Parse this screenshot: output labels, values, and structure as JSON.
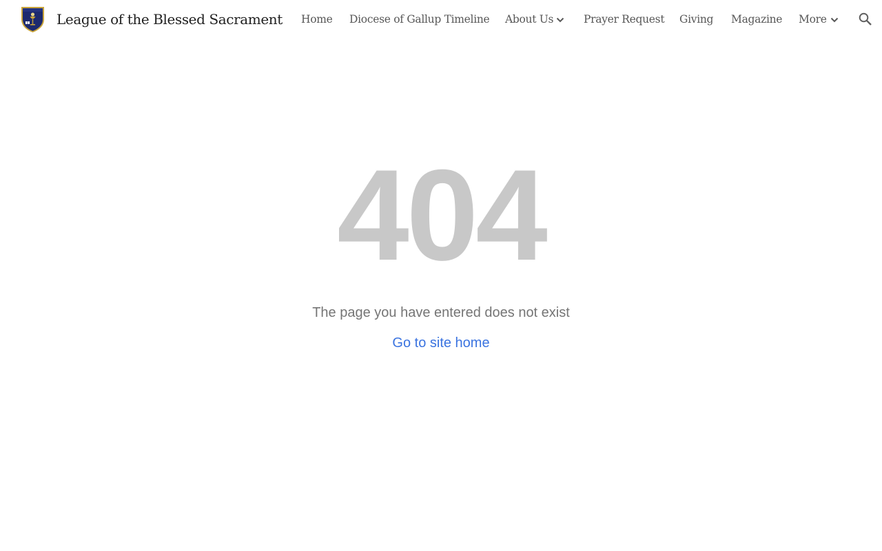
{
  "header": {
    "site_title": "League of the Blessed Sacrament",
    "logo_icon": "shield-crest-icon",
    "nav": {
      "home": "Home",
      "timeline": "Diocese of Gallup Timeline",
      "about": "About Us",
      "prayer": "Prayer Request",
      "giving": "Giving",
      "magazine": "Magazine",
      "more": "More"
    },
    "search_icon": "search-icon"
  },
  "main": {
    "error_code": "404",
    "message": "The page you have entered does not exist",
    "home_link": "Go to site home"
  },
  "colors": {
    "error_code": "#c8c8c8",
    "link": "#3a73e0",
    "nav_text": "#575757",
    "shield_blue": "#1d2a6e",
    "shield_gold": "#c9a43a"
  }
}
